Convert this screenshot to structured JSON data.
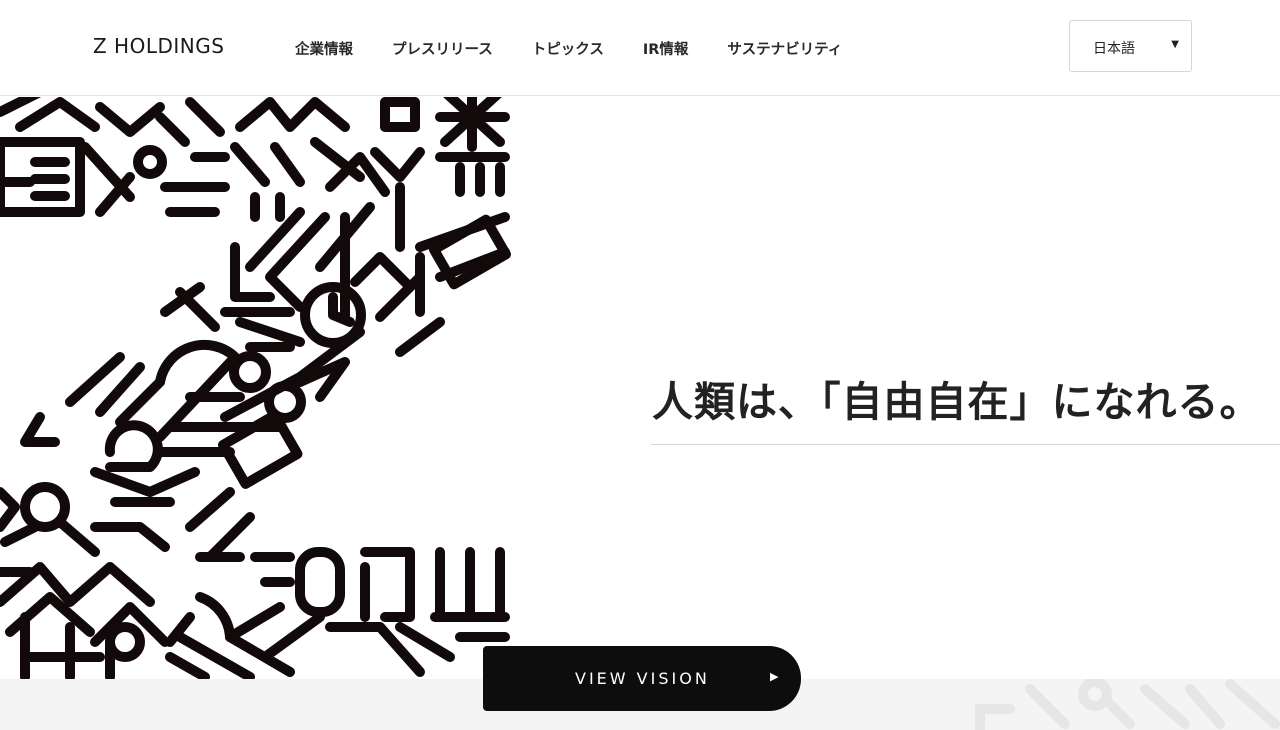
{
  "header": {
    "logo": "Z HOLDINGS",
    "nav": [
      {
        "label": "企業情報"
      },
      {
        "label": "プレスリリース"
      },
      {
        "label": "トピックス"
      },
      {
        "label": "IR情報"
      },
      {
        "label": "サステナビリティ"
      }
    ],
    "language": {
      "selected": "日本語",
      "caret": "▼"
    }
  },
  "hero": {
    "tagline": "人類は、「自由自在」になれる。",
    "button_label": "VIEW VISION",
    "button_arrow": "▶"
  },
  "colors": {
    "ink": "#120a0a",
    "button": "#0d0d0d",
    "band": "#f4f4f4"
  }
}
